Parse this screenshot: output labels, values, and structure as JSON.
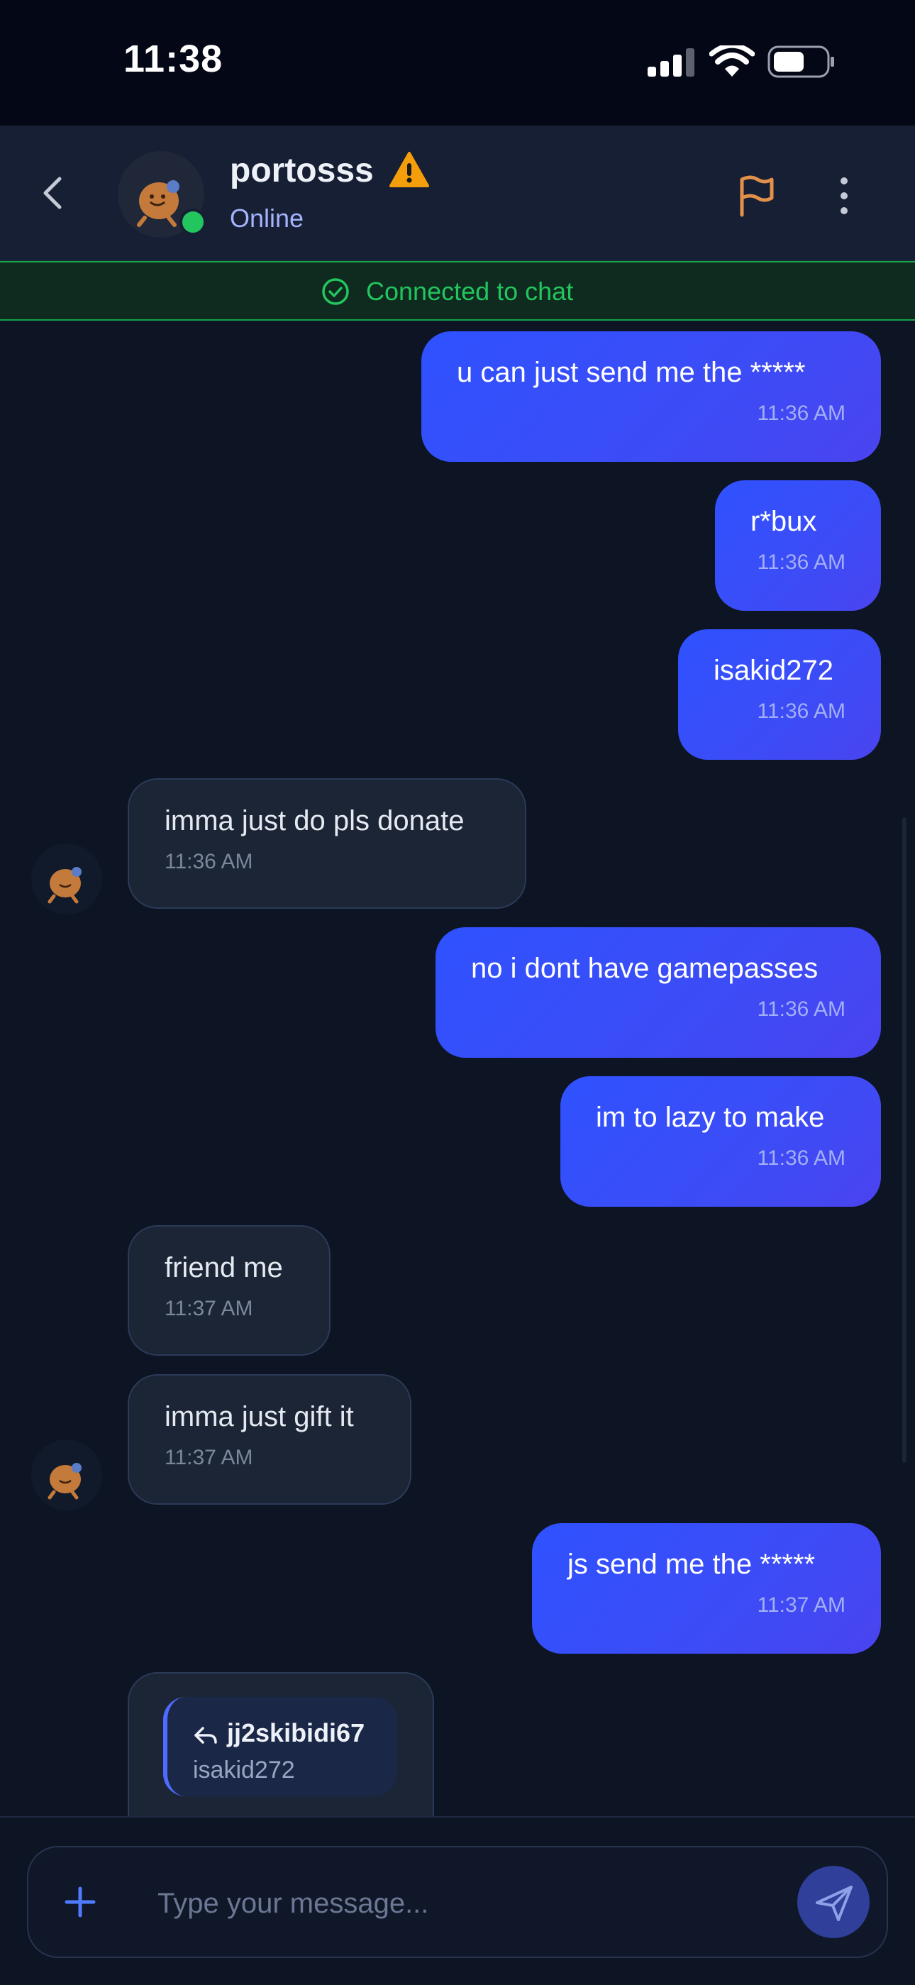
{
  "status_bar": {
    "time": "11:38"
  },
  "header": {
    "contact_name": "portosss",
    "presence": "Online"
  },
  "banner": {
    "text": "Connected to chat"
  },
  "messages": [
    {
      "side": "sent",
      "text": "u can just send me the *****",
      "time": "11:36 AM"
    },
    {
      "side": "sent",
      "text": "r*bux",
      "time": "11:36 AM"
    },
    {
      "side": "sent",
      "text": "isakid272",
      "time": "11:36 AM"
    },
    {
      "side": "recv",
      "text": "imma just do pls donate",
      "time": "11:36 AM"
    },
    {
      "side": "sent",
      "text": "no i dont have gamepasses",
      "time": "11:36 AM"
    },
    {
      "side": "sent",
      "text": "im to lazy to make",
      "time": "11:36 AM"
    },
    {
      "side": "recv",
      "text": "friend me",
      "time": "11:37 AM"
    },
    {
      "side": "recv",
      "text": "imma just gift it",
      "time": "11:37 AM"
    },
    {
      "side": "sent",
      "text": "js send me the *****",
      "time": "11:37 AM"
    }
  ],
  "reply": {
    "user": "jj2skibidi67",
    "text": "isakid272"
  },
  "composer": {
    "placeholder": "Type your message..."
  },
  "colors": {
    "accent": "#2f52ff",
    "online": "#22c55e",
    "warning": "#f59e0b"
  }
}
